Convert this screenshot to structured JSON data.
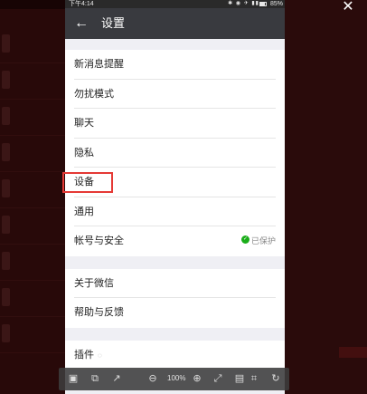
{
  "status_bar": {
    "time": "下午4:14",
    "icons": "✱ ◉ ✈ ▮▮",
    "battery_percent": "85%",
    "battery_level": 0.85
  },
  "header": {
    "back_icon": "arrow-left-icon",
    "title": "设置"
  },
  "groups": [
    {
      "items": [
        "新消息提醒",
        "勿扰模式",
        "聊天",
        "隐私",
        "设备",
        "通用",
        "帐号与安全"
      ]
    },
    {
      "items": [
        "关于微信",
        "帮助与反馈"
      ]
    },
    {
      "items": [
        "插件"
      ]
    }
  ],
  "account_security_status": "已保护",
  "highlighted_item": "设备",
  "toolbar": {
    "zoom_level": "100%",
    "buttons": [
      "save-icon",
      "copy-icon",
      "share-icon",
      "zoom-out-icon",
      "zoom-in-icon",
      "fit-icon",
      "page-icon",
      "crop-icon",
      "rotate-icon"
    ]
  },
  "window": {
    "close_icon": "close-icon"
  },
  "colors": {
    "header_bg": "#393a3f",
    "list_bg": "#ffffff",
    "page_bg": "#efeff4",
    "highlight": "#e53935",
    "protect_green": "#1aad19"
  }
}
